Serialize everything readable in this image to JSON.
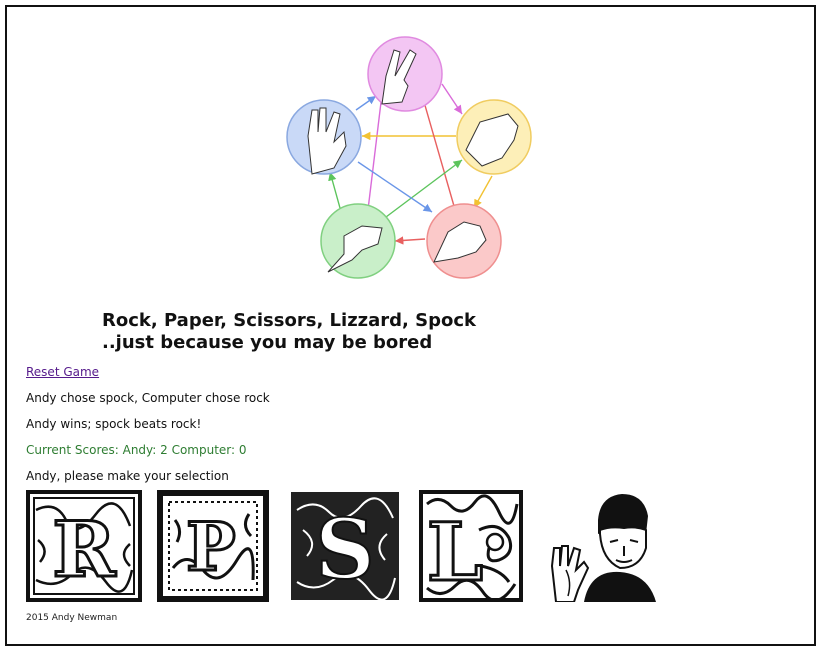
{
  "header": {
    "title": "Rock, Paper, Scissors, Lizzard, Spock",
    "subtitle": "..just because you may be bored"
  },
  "actions": {
    "reset_label": "Reset Game"
  },
  "status": {
    "choice_line": "Andy chose spock, Computer chose rock",
    "result_line": "Andy wins; spock beats rock!",
    "scores_line": "Current Scores: Andy: 2 Computer: 0",
    "prompt_line": "Andy, please make your selection"
  },
  "choices": [
    {
      "letter": "R",
      "name": "rock"
    },
    {
      "letter": "P",
      "name": "paper"
    },
    {
      "letter": "S",
      "name": "scissors"
    },
    {
      "letter": "L",
      "name": "lizard"
    },
    {
      "letter": "",
      "name": "spock"
    }
  ],
  "footer": {
    "text": "2015 Andy Newman"
  },
  "colors": {
    "scores": "#2e7d32",
    "link": "#551a8b",
    "scissors_circle": "#f3c6f3",
    "paper_circle": "#fdefb8",
    "rock_circle": "#fbc9c9",
    "lizard_circle": "#c9efc9",
    "spock_circle": "#c9d9f7"
  }
}
